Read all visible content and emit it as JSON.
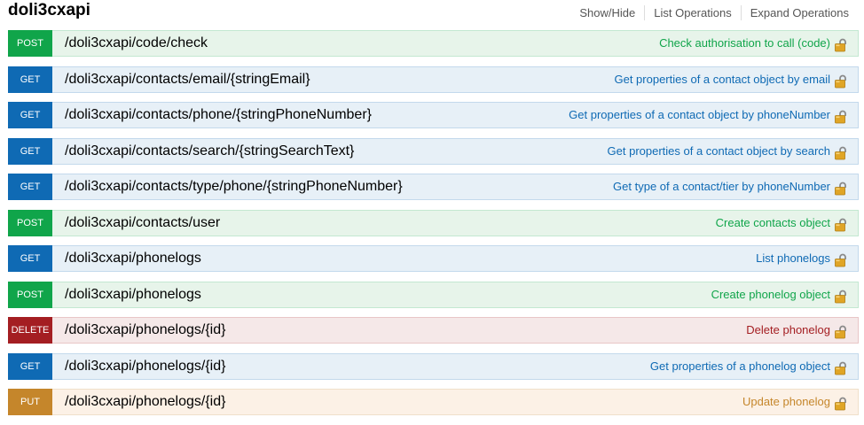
{
  "resource": {
    "title": "doli3cxapi"
  },
  "header_ops": {
    "show_hide": "Show/Hide",
    "list_operations": "List Operations",
    "expand_operations": "Expand Operations"
  },
  "endpoints": [
    {
      "method": "POST",
      "path": "/doli3cxapi/code/check",
      "summary": "Check authorisation to call (code)",
      "icon": "lock-icon"
    },
    {
      "method": "GET",
      "path": "/doli3cxapi/contacts/email/{stringEmail}",
      "summary": "Get properties of a contact object by email",
      "icon": "lock-icon"
    },
    {
      "method": "GET",
      "path": "/doli3cxapi/contacts/phone/{stringPhoneNumber}",
      "summary": "Get properties of a contact object by phoneNumber",
      "icon": "lock-icon"
    },
    {
      "method": "GET",
      "path": "/doli3cxapi/contacts/search/{stringSearchText}",
      "summary": "Get properties of a contact object by search",
      "icon": "lock-icon"
    },
    {
      "method": "GET",
      "path": "/doli3cxapi/contacts/type/phone/{stringPhoneNumber}",
      "summary": "Get type of a contact/tier by phoneNumber",
      "icon": "lock-icon"
    },
    {
      "method": "POST",
      "path": "/doli3cxapi/contacts/user",
      "summary": "Create contacts object",
      "icon": "lock-icon"
    },
    {
      "method": "GET",
      "path": "/doli3cxapi/phonelogs",
      "summary": "List phonelogs",
      "icon": "lock-icon"
    },
    {
      "method": "POST",
      "path": "/doli3cxapi/phonelogs",
      "summary": "Create phonelog object",
      "icon": "lock-icon"
    },
    {
      "method": "DELETE",
      "path": "/doli3cxapi/phonelogs/{id}",
      "summary": "Delete phonelog",
      "icon": "lock-icon"
    },
    {
      "method": "GET",
      "path": "/doli3cxapi/phonelogs/{id}",
      "summary": "Get properties of a phonelog object",
      "icon": "lock-icon"
    },
    {
      "method": "PUT",
      "path": "/doli3cxapi/phonelogs/{id}",
      "summary": "Update phonelog",
      "icon": "lock-icon"
    }
  ],
  "colors": {
    "post": "#10a54a",
    "get": "#0f6ab4",
    "delete": "#a41e22",
    "put": "#c5862b",
    "lock_body": "#e0a526",
    "lock_shackle": "#8a8a8a"
  }
}
